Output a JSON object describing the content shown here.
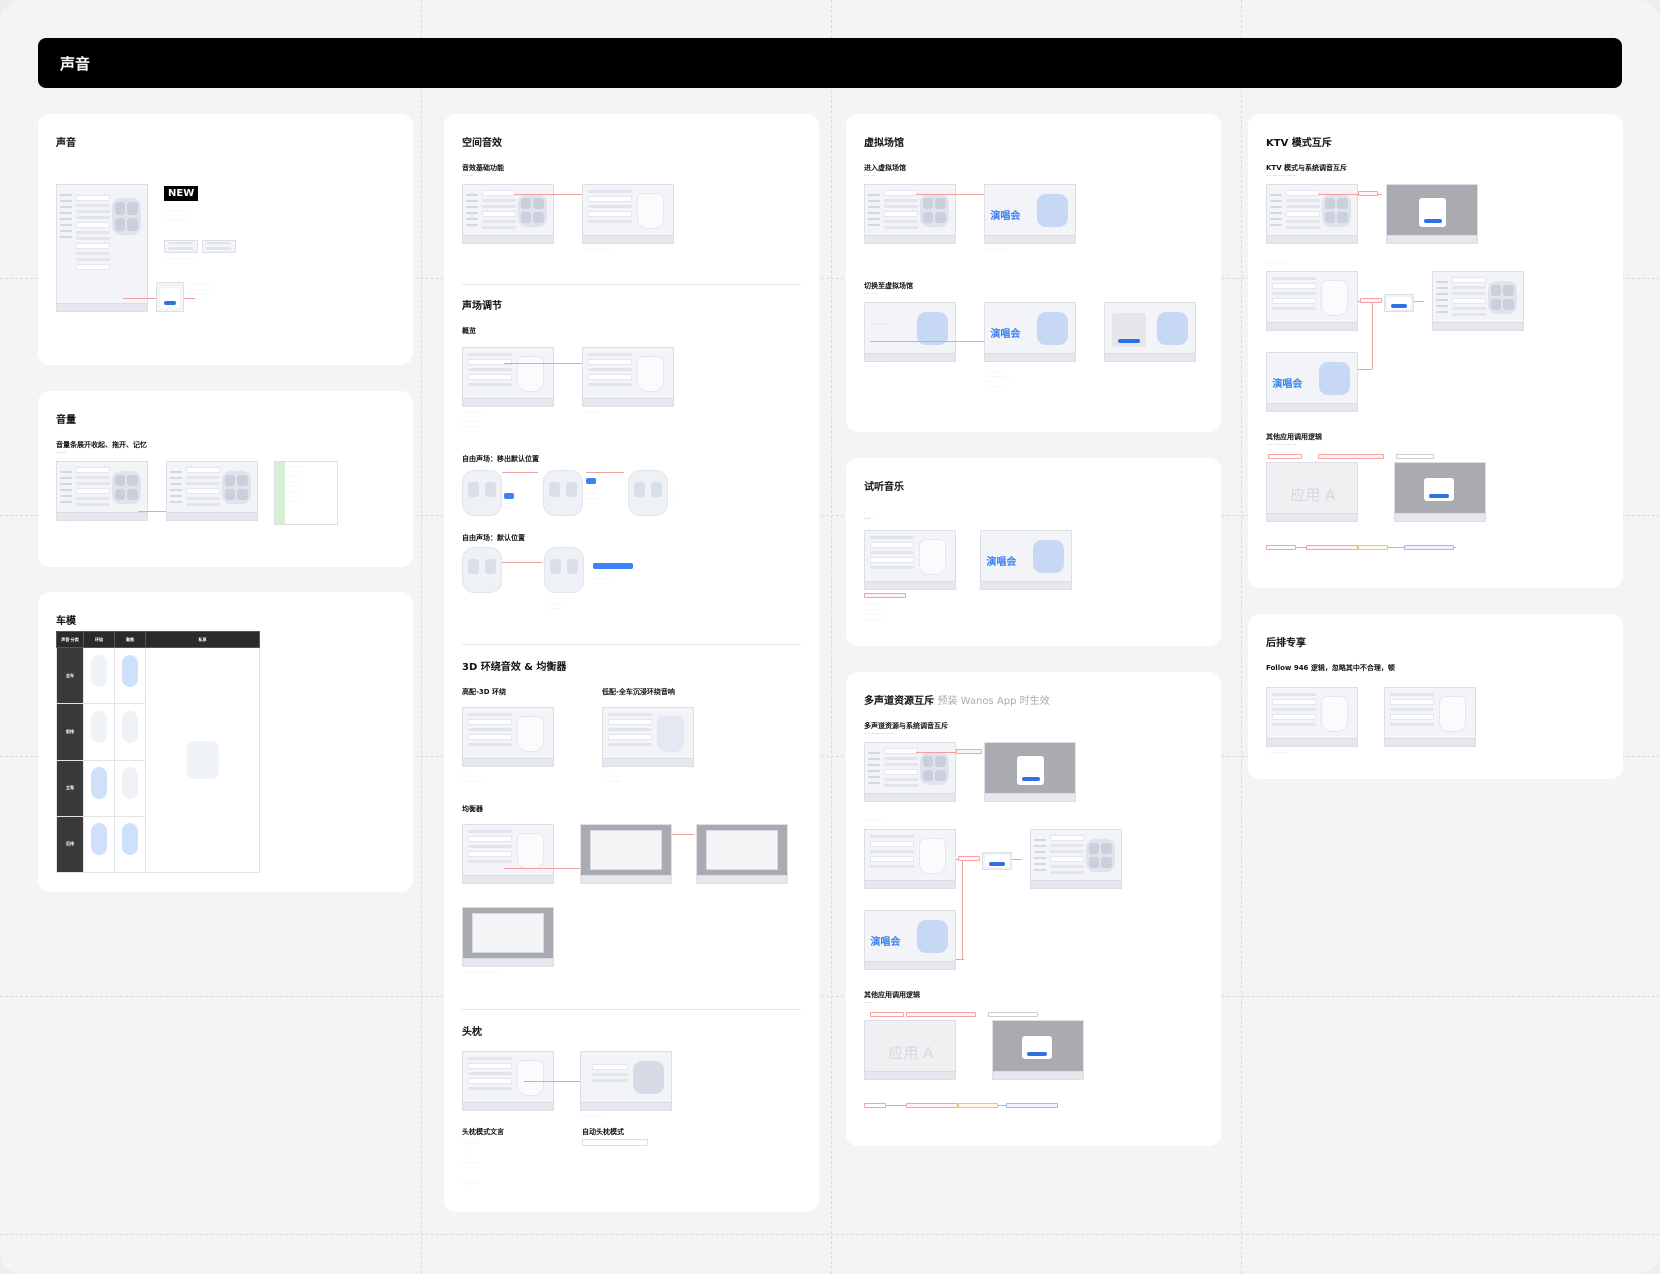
{
  "header": {
    "title": "声音"
  },
  "col1": {
    "sound": {
      "title": "声音",
      "new_badge": "NEW"
    },
    "volume": {
      "title": "音量",
      "sub": "音量条展开收起、拖开、记忆"
    },
    "car": {
      "title": "车模",
      "headers": [
        "声音·分类",
        "环绕",
        "聚焦",
        "私享"
      ],
      "rows": [
        "全车",
        "前排",
        "主驾",
        "后排"
      ]
    }
  },
  "col2": {
    "title": "空间音效",
    "basic": "音效基础功能",
    "field": {
      "title": "声场调节",
      "overview": "概览",
      "free_move": "自由声场：移出默认位置",
      "free_default": "自由声场：默认位置"
    },
    "eq": {
      "title": "3D 环绕音效 & 均衡器",
      "high": "高配-3D 环绕",
      "low": "低配-全车沉浸环绕音响",
      "equalizer": "均衡器"
    },
    "headrest": {
      "title": "头枕",
      "mode_text": "头枕模式文言",
      "auto": "自动头枕模式"
    }
  },
  "col3": {
    "venue": {
      "title": "虚拟场馆",
      "enter": "进入虚拟场馆",
      "switch": "切换至虚拟场馆",
      "stage": "演唱会"
    },
    "trial": {
      "title": "试听音乐",
      "stage": "演唱会"
    },
    "multi": {
      "title": "多声道资源互斥",
      "title_note": "预装 Wanos App 时生效",
      "sub": "多声道资源与系统调音互斥",
      "other": "其他应用调用逻辑",
      "app_label": "应用 A",
      "stage": "演唱会"
    }
  },
  "col4": {
    "ktv": {
      "title": "KTV 模式互斥",
      "sub": "KTV 模式与系统调音互斥",
      "other": "其他应用调用逻辑",
      "app_label": "应用 A",
      "stage": "演唱会"
    },
    "rear": {
      "title": "后排专享",
      "sub": "Follow 946 逻辑，忽略其中不合理，顿"
    }
  }
}
